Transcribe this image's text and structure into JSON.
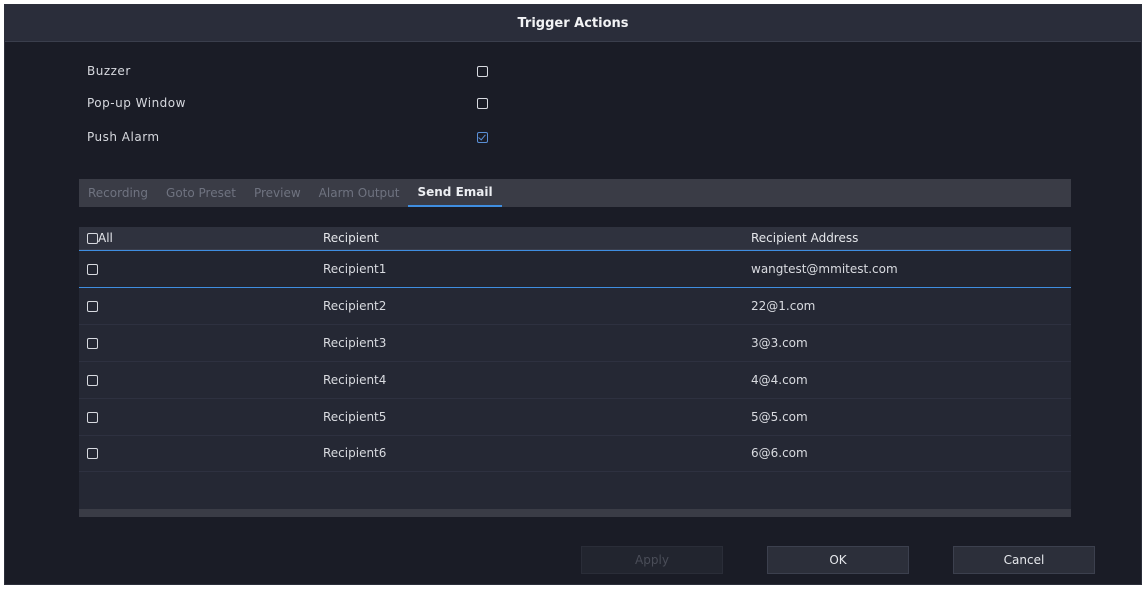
{
  "dialog": {
    "title": "Trigger Actions"
  },
  "options": [
    {
      "label": "Buzzer",
      "checked": false
    },
    {
      "label": "Pop-up Window",
      "checked": false
    },
    {
      "label": "Push Alarm",
      "checked": true
    }
  ],
  "tabs": [
    {
      "label": "Recording",
      "active": false
    },
    {
      "label": "Goto Preset",
      "active": false
    },
    {
      "label": "Preview",
      "active": false
    },
    {
      "label": "Alarm Output",
      "active": false
    },
    {
      "label": "Send Email",
      "active": true
    }
  ],
  "table": {
    "headers": {
      "select_all": "All",
      "recipient": "Recipient",
      "address": "Recipient Address"
    },
    "rows": [
      {
        "name": "Recipient1",
        "address": "wangtest@mmitest.com",
        "checked": false
      },
      {
        "name": "Recipient2",
        "address": "22@1.com",
        "checked": false
      },
      {
        "name": "Recipient3",
        "address": "3@3.com",
        "checked": false
      },
      {
        "name": "Recipient4",
        "address": "4@4.com",
        "checked": false
      },
      {
        "name": "Recipient5",
        "address": "5@5.com",
        "checked": false
      },
      {
        "name": "Recipient6",
        "address": "6@6.com",
        "checked": false
      }
    ]
  },
  "buttons": {
    "apply": "Apply",
    "ok": "OK",
    "cancel": "Cancel"
  },
  "colors": {
    "accent": "#3f8ee0",
    "background": "#1a1c26",
    "titlebar": "#2a2d3a"
  }
}
